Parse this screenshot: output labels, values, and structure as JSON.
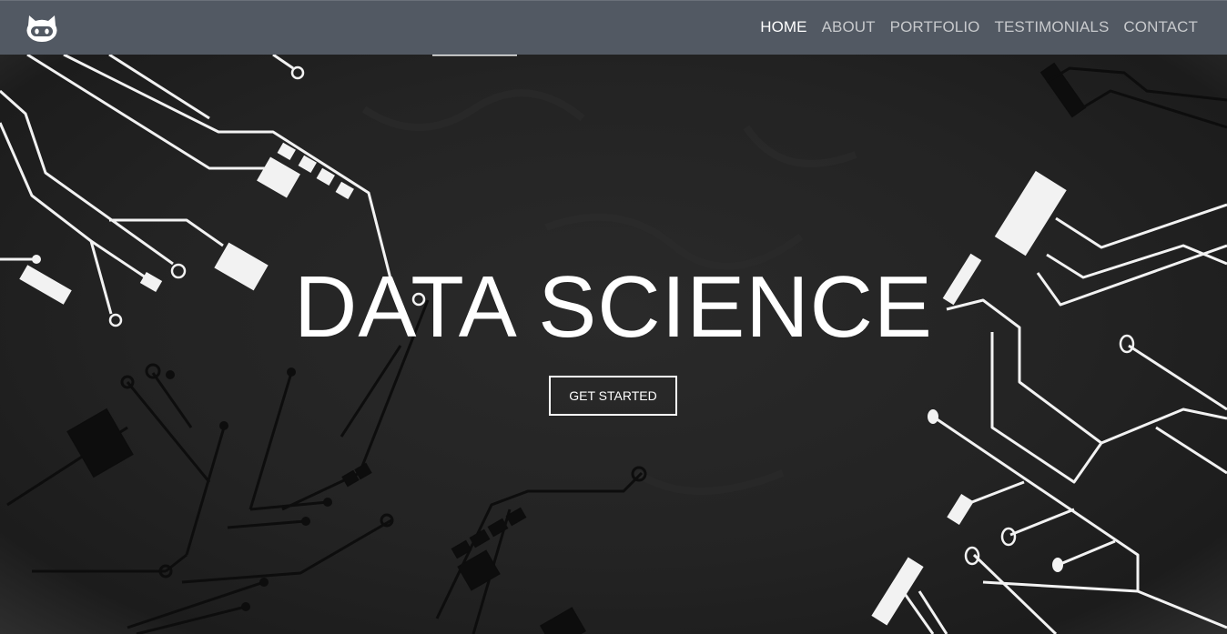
{
  "nav": {
    "logo_icon": "github-octocat-icon",
    "links": [
      {
        "label": "HOME",
        "active": true
      },
      {
        "label": "ABOUT",
        "active": false
      },
      {
        "label": "PORTFOLIO",
        "active": false
      },
      {
        "label": "TESTIMONIALS",
        "active": false
      },
      {
        "label": "CONTACT",
        "active": false
      }
    ]
  },
  "hero": {
    "title": "DATA SCIENCE",
    "cta_label": "GET STARTED",
    "background": "circuit-board-pattern"
  },
  "colors": {
    "navbar_bg": "#525963",
    "hero_bg": "#232323",
    "text": "#ffffff",
    "nav_inactive": "#c7c9cc"
  }
}
